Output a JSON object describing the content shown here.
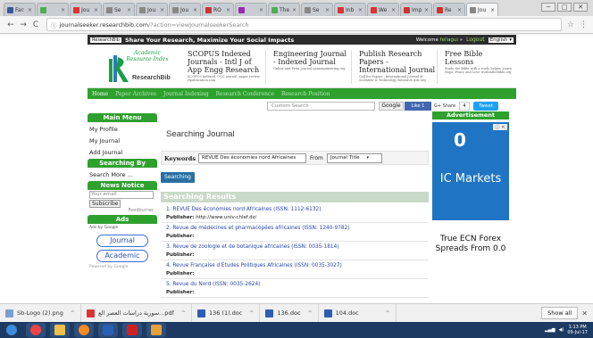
{
  "browser": {
    "tabs": [
      {
        "label": "Fac",
        "color": "#3b5998"
      },
      {
        "label": "",
        "color": "#4caf50"
      },
      {
        "label": "Jou",
        "color": "#d33"
      },
      {
        "label": "Se",
        "color": "#888"
      },
      {
        "label": "Jou",
        "color": "#888"
      },
      {
        "label": "Jou",
        "color": "#888"
      },
      {
        "label": "RO",
        "color": "#c33"
      },
      {
        "label": "",
        "color": "#9c27b0"
      },
      {
        "label": "The",
        "color": "#4caf50"
      },
      {
        "label": "Se",
        "color": "#888"
      },
      {
        "label": "Inb",
        "color": "#d33"
      },
      {
        "label": "We",
        "color": "#d33"
      },
      {
        "label": "Imp",
        "color": "#c33"
      },
      {
        "label": "Re",
        "color": "#c33"
      },
      {
        "label": "Jou",
        "color": "#888"
      }
    ],
    "url_host": "journalseeker.researchbib.com",
    "url_path": "/?action=viewJournalseekerSearch",
    "back_icon": "←",
    "forward_icon": "→",
    "reload_icon": "C"
  },
  "site": {
    "logo_badge": "ResearchBib",
    "tagline": "Share Your Research, Maximize Your Social Impacts",
    "welcome": "Welcome",
    "username": "fellagui",
    "logout": "Logout",
    "language": "English ▾",
    "logo_text": "Academic Resource Index",
    "logo_name": "ResearchBib",
    "ads": [
      {
        "title": "SCOPUS Indexed Journals - Intl J of App Engg Research",
        "sub": "SCOPUS Indexed, UGC journal, paper review, ripublication.com"
      },
      {
        "title": "Engineering Journal - Indexed Journal",
        "sub": "Online and Print Journal ijemengineering.org"
      },
      {
        "title": "Publish Research Papers - International Journal",
        "sub": "Call for Papers - International Journal of Scientific & Technology Research ijstr.org"
      },
      {
        "title": "Free Bible Lessons",
        "sub": "Study the Bible with a study helper. Learn Hope, Peace and Love truthinthebible.org"
      }
    ],
    "nav": [
      "Home",
      "Paper Archives",
      "Journal Indexing",
      "Research Conference",
      "Research Position"
    ],
    "custom_search": "Custom Search",
    "google_btn": "Google",
    "like": "Like 1",
    "gshare": "G+ Share",
    "gcount": "4",
    "tweet": "Tweet"
  },
  "sidebar": {
    "main_menu": "Main Menu",
    "items": [
      "My Profile",
      "My Journal",
      "Add Journal"
    ],
    "searching_by": "Searching By",
    "search_more": "Search More ...",
    "news_notice": "News Notice",
    "email_placeholder": "Your email",
    "subscribe": "Subscribe",
    "feedburner": "Feedburner",
    "ads_head": "Ads",
    "ads_by": "Ads by Google",
    "ad_links": [
      "Journal",
      "Academic"
    ],
    "powered": "Powered by Google"
  },
  "main": {
    "title": "Searching Journal",
    "keywords_label": "Keywords",
    "keyword_value": "REVUE Des économies nord Africaines",
    "from_label": "From",
    "from_value": "Journal Title",
    "search_button": "Searching",
    "results_head": "Searching Results",
    "publisher_label": "Publisher:",
    "results": [
      {
        "title": "1. REVUE Des économies nord Africaines (ISSN: 1112-6132)",
        "publisher": "http://www.univ-chlef.dz/"
      },
      {
        "title": "2. Revue de médecines et pharmacopées africaines (ISSN: 1240-9782)",
        "publisher": ""
      },
      {
        "title": "3. Revue de zoologie et de botanique africaines (ISSN: 0035-1814)",
        "publisher": ""
      },
      {
        "title": "4. Revue Française d'Études Politiques Africaines (ISSN: 0035-3027)",
        "publisher": ""
      },
      {
        "title": "5. Revue du Nord (ISSN: 0035-2624)",
        "publisher": ""
      }
    ]
  },
  "right": {
    "adv_head": "Advertisement",
    "zero": "0",
    "ic_text": "IC Markets",
    "ecn_text": "True ECN Forex Spreads From 0.0"
  },
  "downloads": {
    "items": [
      "Sb-Logo (2).png",
      "سورية دراسات العصر الع...pdf",
      "136 (1).doc",
      "136.doc",
      "104.doc"
    ],
    "show_all": "Show all"
  },
  "taskbar": {
    "clock_time": "1:13 PM",
    "clock_date": "09-Jul-17"
  }
}
